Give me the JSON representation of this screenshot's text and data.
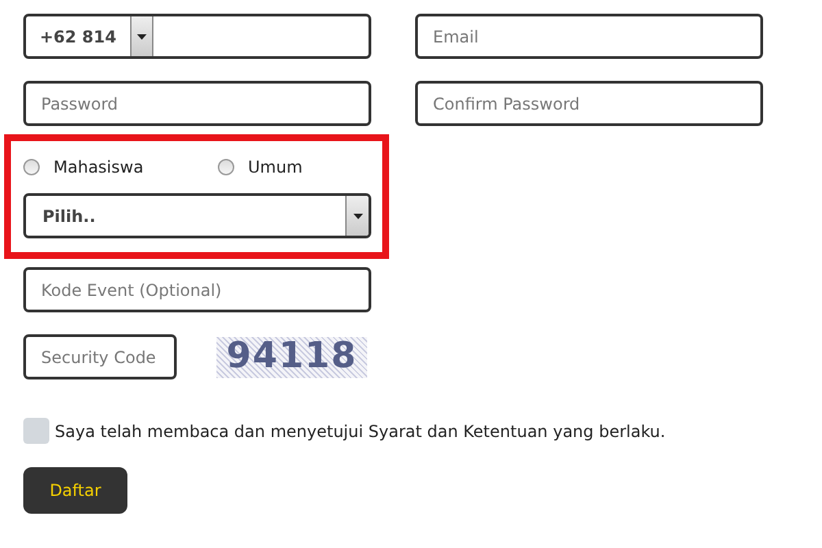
{
  "phone": {
    "prefix": "+62 814"
  },
  "email": {
    "placeholder": "Email"
  },
  "password": {
    "placeholder": "Password"
  },
  "confirm_password": {
    "placeholder": "Confirm Password"
  },
  "category": {
    "highlighted": true,
    "options": [
      {
        "label": "Mahasiswa",
        "selected": false
      },
      {
        "label": "Umum",
        "selected": false
      }
    ],
    "select": {
      "value": "Pilih.."
    }
  },
  "event_code": {
    "placeholder": "Kode Event (Optional)"
  },
  "security_code": {
    "placeholder": "Security Code"
  },
  "captcha": {
    "text": "94118"
  },
  "agreement": {
    "checked": false,
    "text": "Saya telah membaca dan menyetujui Syarat dan Ketentuan yang berlaku."
  },
  "submit": {
    "label": "Daftar"
  }
}
